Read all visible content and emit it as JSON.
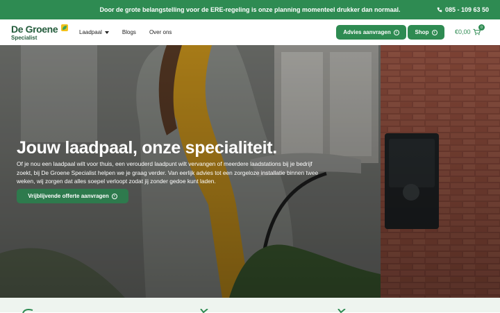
{
  "topbar": {
    "message": "Door de grote belangstelling voor de ERE-regeling is onze planning momenteel drukker dan normaal.",
    "phone": "085 - 109 63 50"
  },
  "brand": {
    "name_line1": "De Groene",
    "name_line2": "Specialist"
  },
  "nav": {
    "items": [
      {
        "label": "Laadpaal"
      },
      {
        "label": "Blogs"
      },
      {
        "label": "Over ons"
      }
    ]
  },
  "buttons": {
    "advies": "Advies aanvragen",
    "shop": "Shop"
  },
  "cart": {
    "total": "€0,00",
    "count": "0"
  },
  "hero": {
    "title": "Jouw laadpaal, onze specialiteit.",
    "body": "Of je nou een laadpaal wilt voor thuis, een verouderd laadpunt wilt vervangen of meerdere laadstations bij je bedrijf zoekt, bij De Groene Specialist helpen we je graag verder. Van eerlijk advies tot een zorgeloze installatie binnen twee weken, wij zorgen dat alles soepel verloopt zodat jij zonder gedoe kunt laden.",
    "cta": "Vrijblijvende offerte aanvragen"
  },
  "colors": {
    "brand_green": "#2e8b52",
    "dark_green": "#245c3c",
    "strip_bg": "#eef4ef"
  },
  "icons": [
    "phone-icon",
    "chevron-down-icon",
    "arrow-circle-icon",
    "cart-icon",
    "leaf-icon",
    "check-icon"
  ]
}
